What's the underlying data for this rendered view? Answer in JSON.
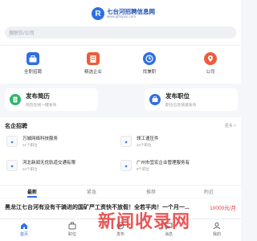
{
  "header": {
    "logo_letter": "R",
    "site_name": "七台河招聘信息网",
    "site_domain": "www.qthzpxx.com"
  },
  "search": {
    "placeholder": "搜职位/公司"
  },
  "quick_links": [
    {
      "label": "全职招聘",
      "icon": "briefcase-icon",
      "color": "#2f6ee5"
    },
    {
      "label": "精选企业",
      "icon": "building-icon",
      "color": "#ef5b3a"
    },
    {
      "label": "找兼职",
      "icon": "clock-icon",
      "color": "#2f6ee5"
    },
    {
      "label": "公司",
      "icon": "location-pin-icon",
      "color": "#ef5b3a"
    }
  ],
  "promos": [
    {
      "title": "发布简历",
      "subtitle": "简历在线一键发布",
      "icon": "resume-icon",
      "color": "#2fb56b"
    },
    {
      "title": "发布职位",
      "subtitle": "职位信息快速发布",
      "icon": "post-job-icon",
      "color": "#2f6ee5"
    }
  ],
  "companies_section": {
    "title": "名企招聘",
    "more": "更多 >",
    "items": [
      {
        "name": "万城网络科技服务",
        "jobs": "21个职位"
      },
      {
        "name": "领工速压件",
        "jobs": "24个职位"
      },
      {
        "name": "河北新闻无优轨道交通有限",
        "jobs": "24个职位"
      },
      {
        "name": "广州市宜宏企业管理服务有",
        "jobs": "9个职位"
      }
    ]
  },
  "job_tabs": [
    "最新",
    "紧急",
    "推荐",
    "附近"
  ],
  "job_listing": {
    "title": "黑龙江七台河有没有干骑进的国矿严工资快不放假！全若平肉！一个月一...",
    "salary": "10000元/月"
  },
  "bottom_nav": [
    {
      "label": "首页",
      "icon": "home-icon"
    },
    {
      "label": "职位",
      "icon": "briefcase-icon"
    },
    {
      "label": "发布",
      "icon": "plus-icon"
    },
    {
      "label": "消息",
      "icon": "message-icon"
    },
    {
      "label": "我的",
      "icon": "user-icon"
    }
  ],
  "watermark": "新闻收录网",
  "colors": {
    "accent": "#2f6ee5",
    "salary": "#e23b3b"
  }
}
